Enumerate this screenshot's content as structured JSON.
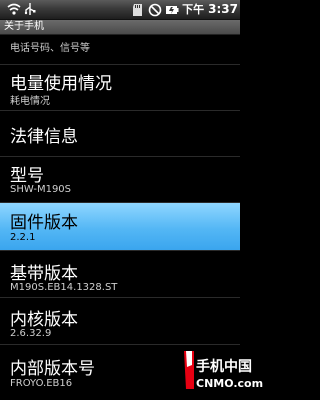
{
  "status_bar": {
    "icons": [
      "wifi-icon",
      "usb-icon",
      "sd-card-icon",
      "no-signal-icon",
      "battery-icon"
    ],
    "period": "下午",
    "time": "3:37"
  },
  "title_bar": {
    "title": "关于手机"
  },
  "items": [
    {
      "title": "",
      "subtitle": "电话号码、信号等"
    },
    {
      "title": "电量使用情况",
      "subtitle": "耗电情况"
    },
    {
      "title": "法律信息",
      "subtitle": ""
    },
    {
      "title": "型号",
      "subtitle": "SHW-M190S"
    },
    {
      "title": "固件版本",
      "subtitle": "2.2.1",
      "selected": true
    },
    {
      "title": "基带版本",
      "subtitle": "M190S.EB14.1328.ST"
    },
    {
      "title": "内核版本",
      "subtitle": "2.6.32.9"
    },
    {
      "title": "内部版本号",
      "subtitle": "FROYO.EB16"
    }
  ],
  "watermark": {
    "line1": "手机中国",
    "line2": "CNMO.com"
  },
  "colors": {
    "selection": "#54b7f5",
    "background": "#000000",
    "watermark": "#e60012"
  }
}
